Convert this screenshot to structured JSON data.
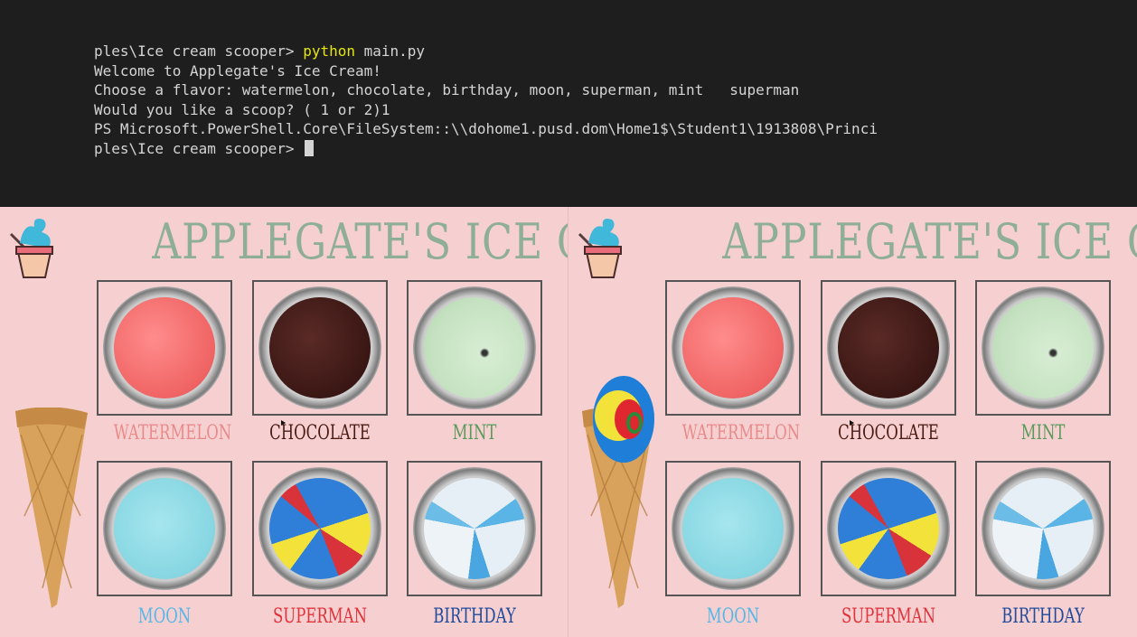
{
  "terminal": {
    "lines": [
      {
        "prefix": "ples\\Ice cream scooper> ",
        "cmd": "python",
        "rest": " main.py"
      },
      {
        "text": "Welcome to Applegate's Ice Cream!"
      },
      {
        "text": "Choose a flavor: watermelon, chocolate, birthday, moon, superman, mint   superman"
      },
      {
        "text": "Would you like a scoop? ( 1 or 2)1"
      },
      {
        "text": "PS Microsoft.PowerShell.Core\\FileSystem::\\\\dohome1.pusd.dom\\Home1$\\Student1\\1913808\\Princi"
      },
      {
        "text": "ples\\Ice cream scooper> "
      }
    ]
  },
  "game": {
    "title": "APPLEGATE'S ICE CREAM",
    "flavors": [
      {
        "name": "WATERMELON",
        "color": "#e98a8a",
        "scoop": "#f26b6b"
      },
      {
        "name": "CHOCOLATE",
        "color": "#4a1a12",
        "scoop": "#3a1714"
      },
      {
        "name": "MINT",
        "color": "#5a9a5a",
        "scoop": "#cfe6cc"
      },
      {
        "name": "MOON",
        "color": "#56b7e6",
        "scoop": "#8fdbe6"
      },
      {
        "name": "SUPERMAN",
        "color": "#e0333a",
        "scoop": "#2f7fd8"
      },
      {
        "name": "BIRTHDAY",
        "color": "#1f4a9a",
        "scoop": "#dfe8f2"
      }
    ]
  },
  "colors": {
    "terminal_bg": "#1e1e1e",
    "title": "#8fae98",
    "panel_bg": "#f6d0d1"
  }
}
